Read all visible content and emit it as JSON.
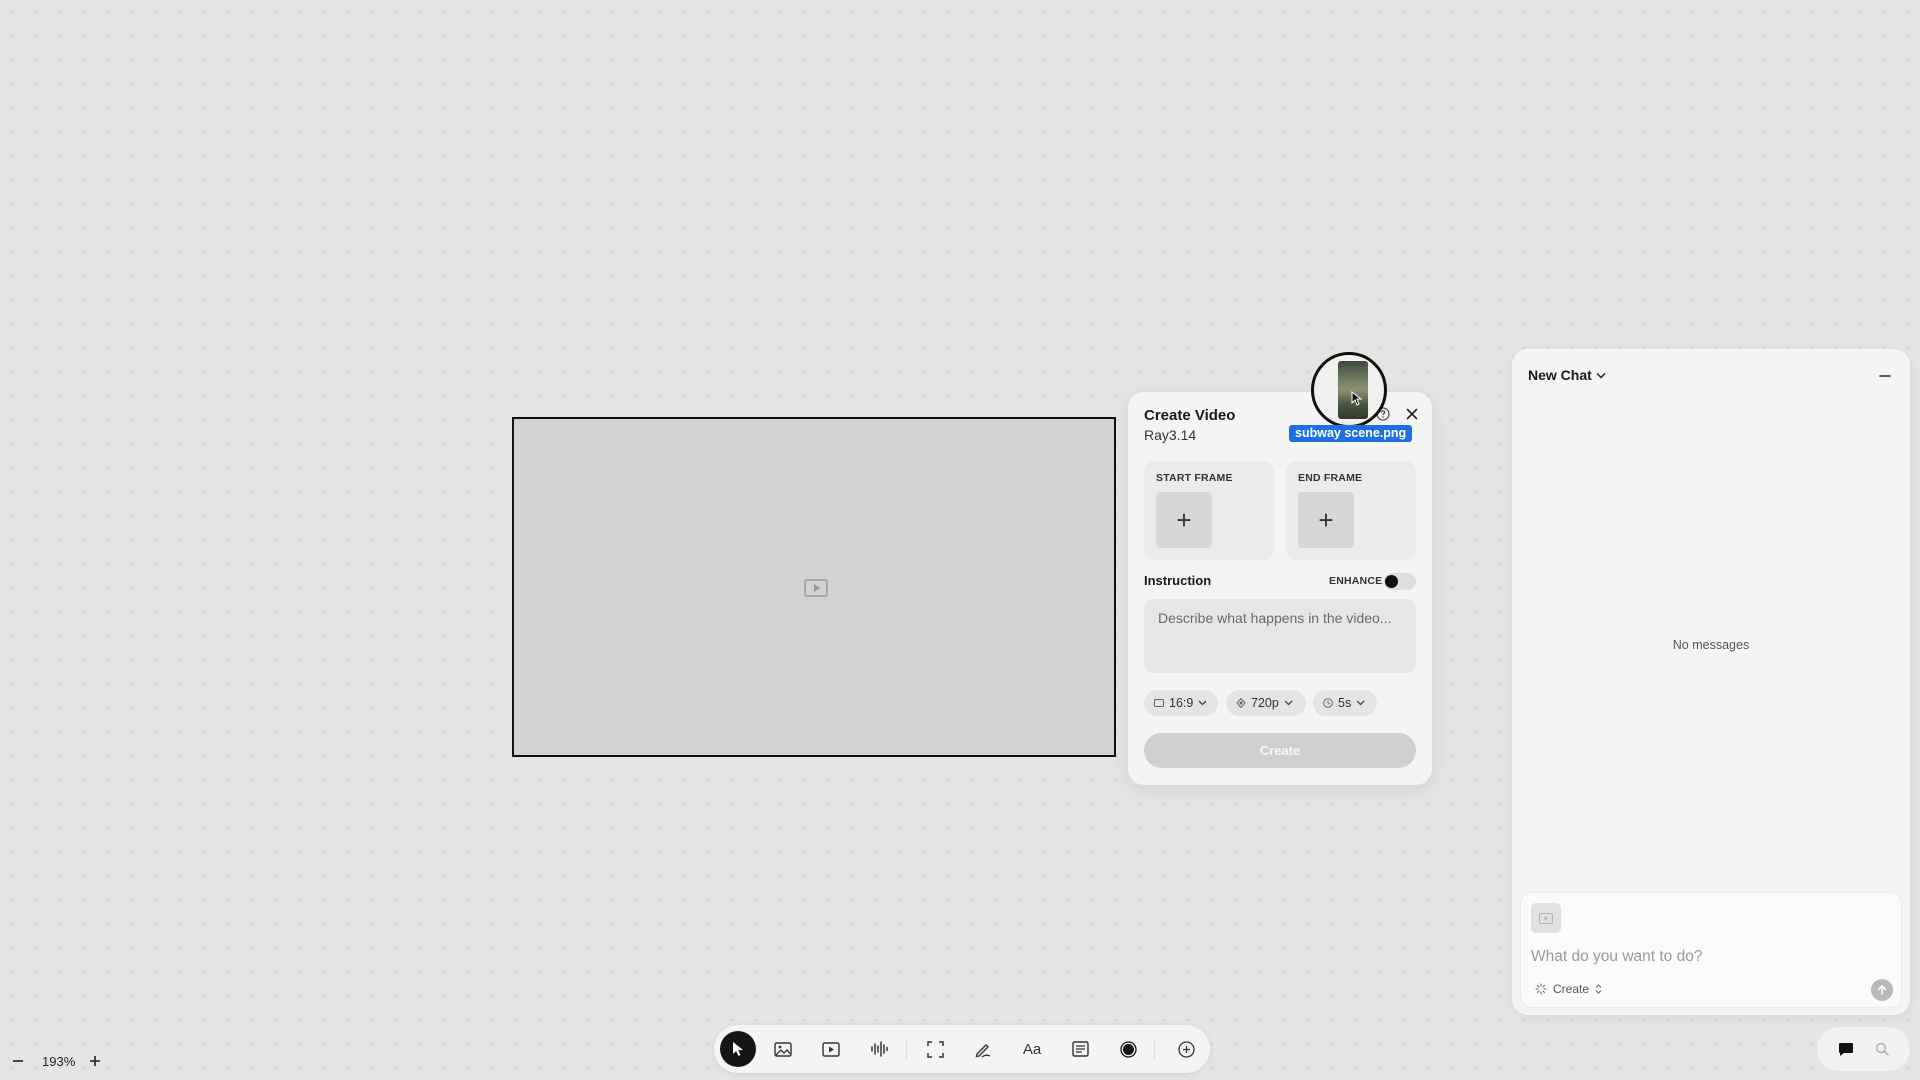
{
  "create_video": {
    "title": "Create Video",
    "model": "Ray3.14",
    "start_frame_label": "START FRAME",
    "end_frame_label": "END FRAME",
    "add_symbol": "+",
    "instruction_label": "Instruction",
    "enhance_label": "ENHANCE",
    "enhance_on": false,
    "instruction_placeholder": "Describe what happens in the video...",
    "aspect_ratio": "16:9",
    "resolution": "720p",
    "duration": "5s",
    "create_label": "Create"
  },
  "drag": {
    "file_name": "subway scene.png"
  },
  "chat": {
    "title": "New Chat",
    "empty_text": "No messages",
    "input_placeholder": "What do you want to do?",
    "mode": "Create"
  },
  "zoom": {
    "level": "193%"
  },
  "toolbar": {
    "tools": [
      "select-icon",
      "image-icon",
      "video-icon",
      "audio-icon",
      "frame-icon",
      "draw-icon",
      "text-icon",
      "note-icon",
      "record-icon",
      "add-icon"
    ],
    "text_tool_label": "Aa"
  },
  "colors": {
    "canvas": "#e4e4e3",
    "panel": "#f4f4f3",
    "accent_tag": "#1f6fe0",
    "active_tool": "#151515"
  }
}
